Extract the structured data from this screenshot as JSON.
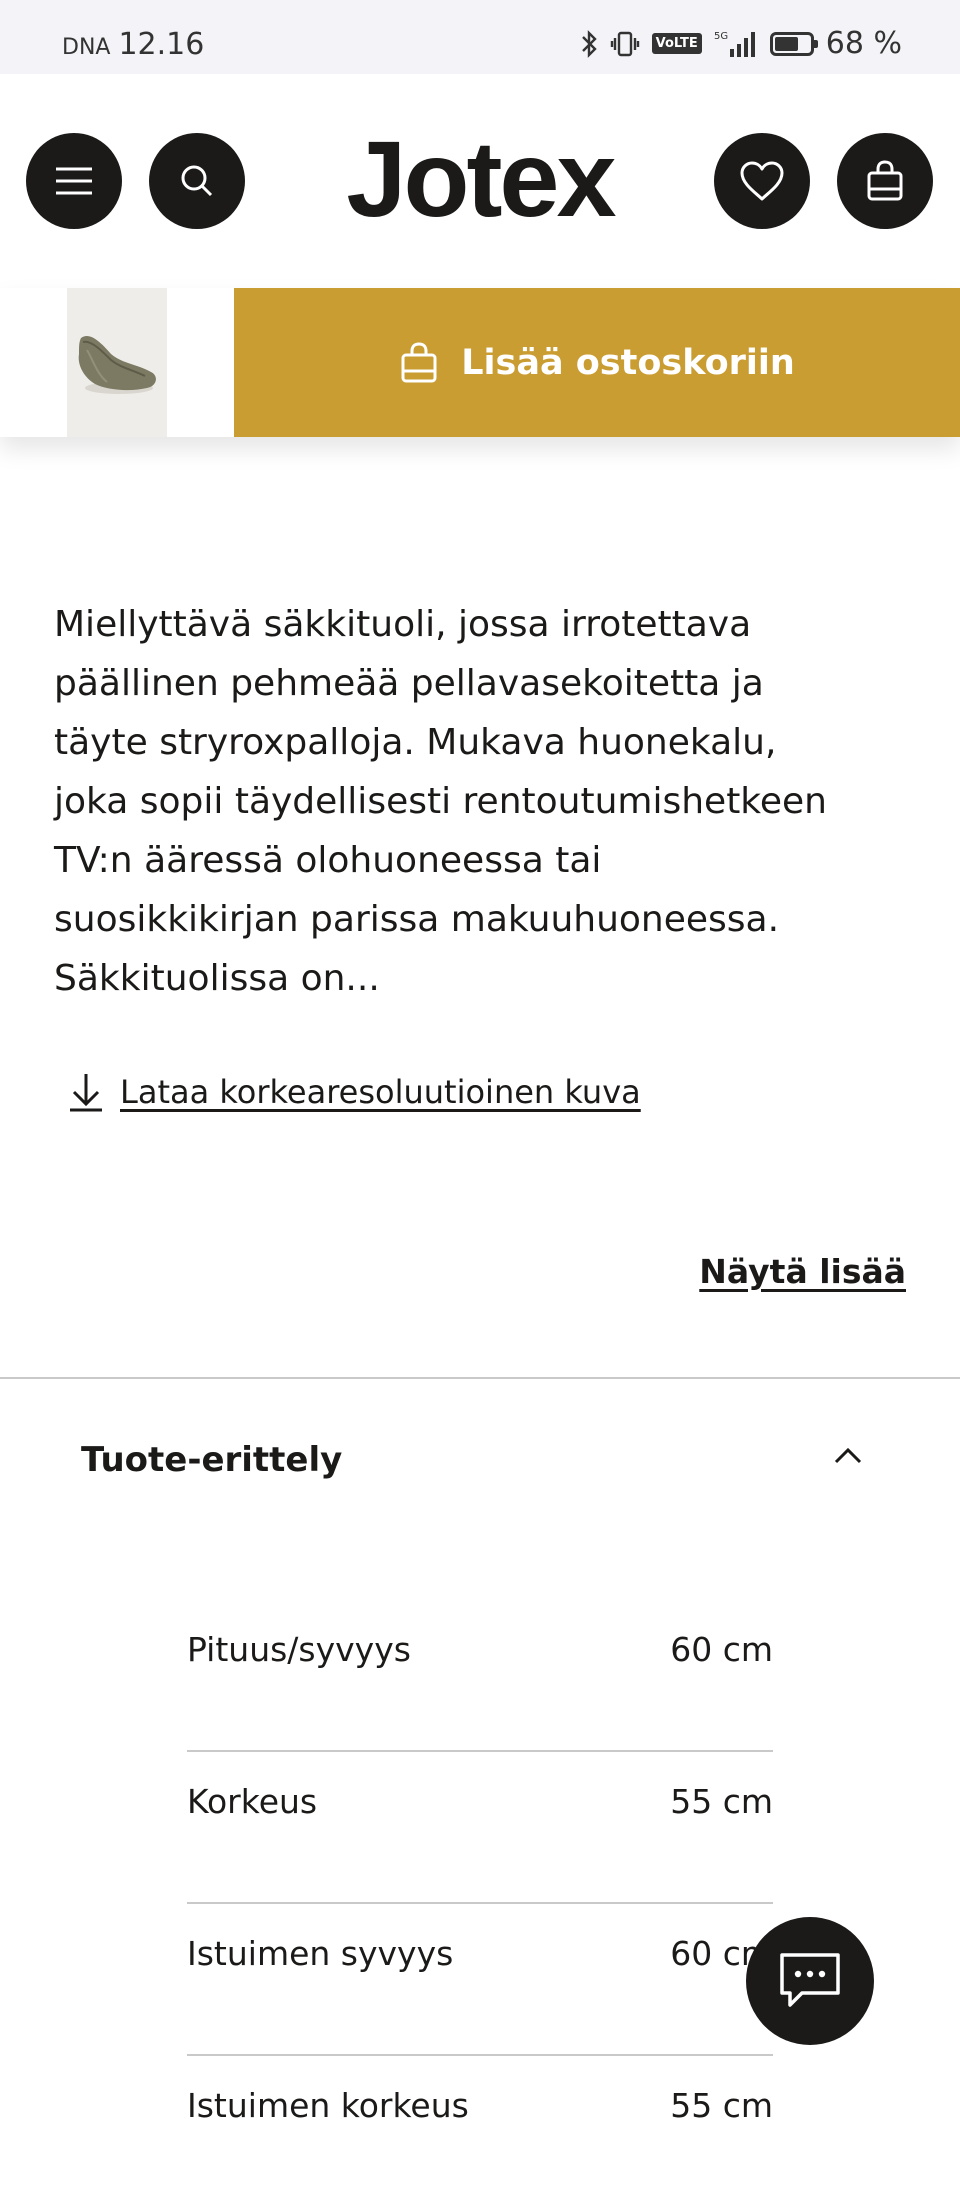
{
  "status_bar": {
    "carrier": "DNA",
    "time": "12.16",
    "network": "5G",
    "volte": "VoLTE",
    "battery_text": "68 %",
    "battery_level": 0.68
  },
  "header": {
    "logo": "Jotex",
    "icons": [
      "menu-icon",
      "search-icon",
      "heart-icon",
      "shopping-bag-icon"
    ]
  },
  "sticky_bar": {
    "add_to_cart_label": "Lisää ostoskoriin",
    "accent_color": "#c99d32"
  },
  "description": {
    "text": "Miellyttävä säkkituoli, jossa irrotettava\npäällinen pehmeää pellavasekoitetta ja\ntäyte stryroxpalloja. Mukava huonekalu,\njoka sopii täydellisesti rentoutumishetkeen\nTV:n ääressä olohuoneessa tai\nsuosikkikirjan parissa makuuhuoneessa.\nSäkkituolissa on...",
    "download_label": "Lataa korkearesoluutioinen kuva",
    "show_more_label": "Näytä lisää"
  },
  "specs": {
    "title": "Tuote-erittely",
    "rows": [
      {
        "label": "Pituus/syvyys",
        "value": "60 cm"
      },
      {
        "label": "Korkeus",
        "value": "55 cm"
      },
      {
        "label": "Istuimen syvyys",
        "value": "60 cm"
      },
      {
        "label": "Istuimen korkeus",
        "value": "55 cm"
      }
    ]
  }
}
